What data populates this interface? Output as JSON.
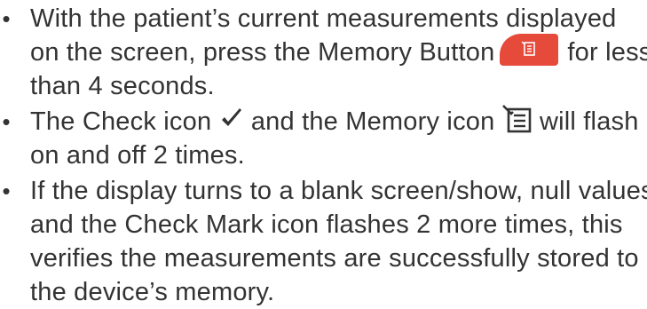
{
  "bullets": [
    {
      "marker": "•",
      "line1": "With the patient’s current measurements displayed",
      "line2_before": "on the screen, press the Memory Button",
      "line2_after": "for less",
      "line3": "than 4 seconds."
    },
    {
      "marker": "•",
      "line1_a": "The Check icon",
      "line1_b": "and the Memory icon",
      "line1_c": "will flash",
      "line2": "on and off 2 times."
    },
    {
      "marker": "•",
      "line1": "If the display turns to a blank screen/show, null values,",
      "line2": "and the Check Mark icon flashes 2 more times, this",
      "line3": "verifies the measurements are successfully stored to",
      "line4": "the device’s memory."
    }
  ],
  "icons": {
    "memory_button": "memory-icon",
    "check": "check-icon",
    "memory": "memory-icon"
  },
  "colors": {
    "text": "#333333",
    "memory_button": "#e64a3b"
  }
}
